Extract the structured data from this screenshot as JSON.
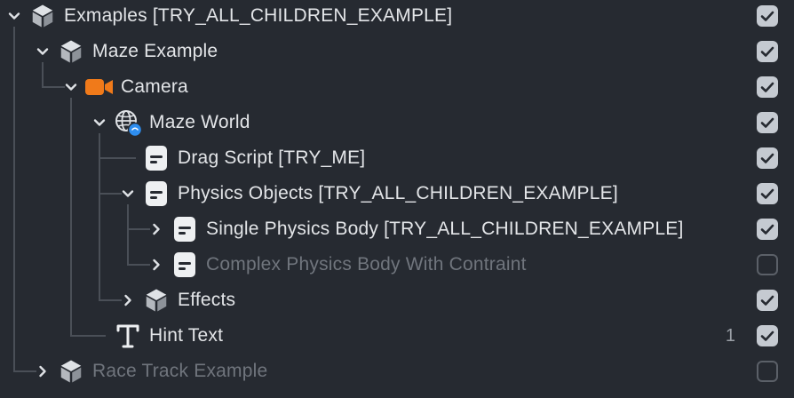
{
  "rows": [
    {
      "name": "exmaples",
      "label": "Exmaples [TRY_ALL_CHILDREN_EXAMPLE]",
      "icon": "object-cube-icon",
      "chevron": "down",
      "checked": true,
      "dim": false,
      "badge": ""
    },
    {
      "name": "maze-example",
      "label": "Maze Example",
      "icon": "object-cube-icon",
      "chevron": "down",
      "checked": true,
      "dim": false,
      "badge": ""
    },
    {
      "name": "camera",
      "label": "Camera",
      "icon": "camera-icon",
      "chevron": "down",
      "checked": true,
      "dim": false,
      "badge": ""
    },
    {
      "name": "maze-world",
      "label": "Maze World",
      "icon": "world-globe-icon",
      "chevron": "down",
      "checked": true,
      "dim": false,
      "badge": ""
    },
    {
      "name": "drag-script",
      "label": "Drag Script [TRY_ME]",
      "icon": "script-icon",
      "chevron": "",
      "checked": true,
      "dim": false,
      "badge": ""
    },
    {
      "name": "physics-objects",
      "label": "Physics Objects [TRY_ALL_CHILDREN_EXAMPLE]",
      "icon": "script-icon",
      "chevron": "down",
      "checked": true,
      "dim": false,
      "badge": ""
    },
    {
      "name": "single-physics-body",
      "label": "Single Physics Body [TRY_ALL_CHILDREN_EXAMPLE]",
      "icon": "script-icon",
      "chevron": "right",
      "checked": true,
      "dim": false,
      "badge": ""
    },
    {
      "name": "complex-physics-body",
      "label": "Complex Physics Body With Contraint",
      "icon": "script-icon",
      "chevron": "right",
      "checked": false,
      "dim": true,
      "badge": ""
    },
    {
      "name": "effects",
      "label": "Effects",
      "icon": "object-cube-icon",
      "chevron": "right",
      "checked": true,
      "dim": false,
      "badge": ""
    },
    {
      "name": "hint-text",
      "label": "Hint Text",
      "icon": "text-icon",
      "chevron": "",
      "checked": true,
      "dim": false,
      "badge": "1"
    },
    {
      "name": "race-track-example",
      "label": "Race Track Example",
      "icon": "object-cube-icon",
      "chevron": "right",
      "checked": false,
      "dim": true,
      "badge": ""
    }
  ],
  "colors": {
    "background": "#262a31",
    "text": "#e3e5e8",
    "dim_text": "#70757d",
    "camera_accent": "#f07a1a",
    "globe_accent": "#2e8ef0",
    "checkbox_on": "#c5cad1"
  }
}
